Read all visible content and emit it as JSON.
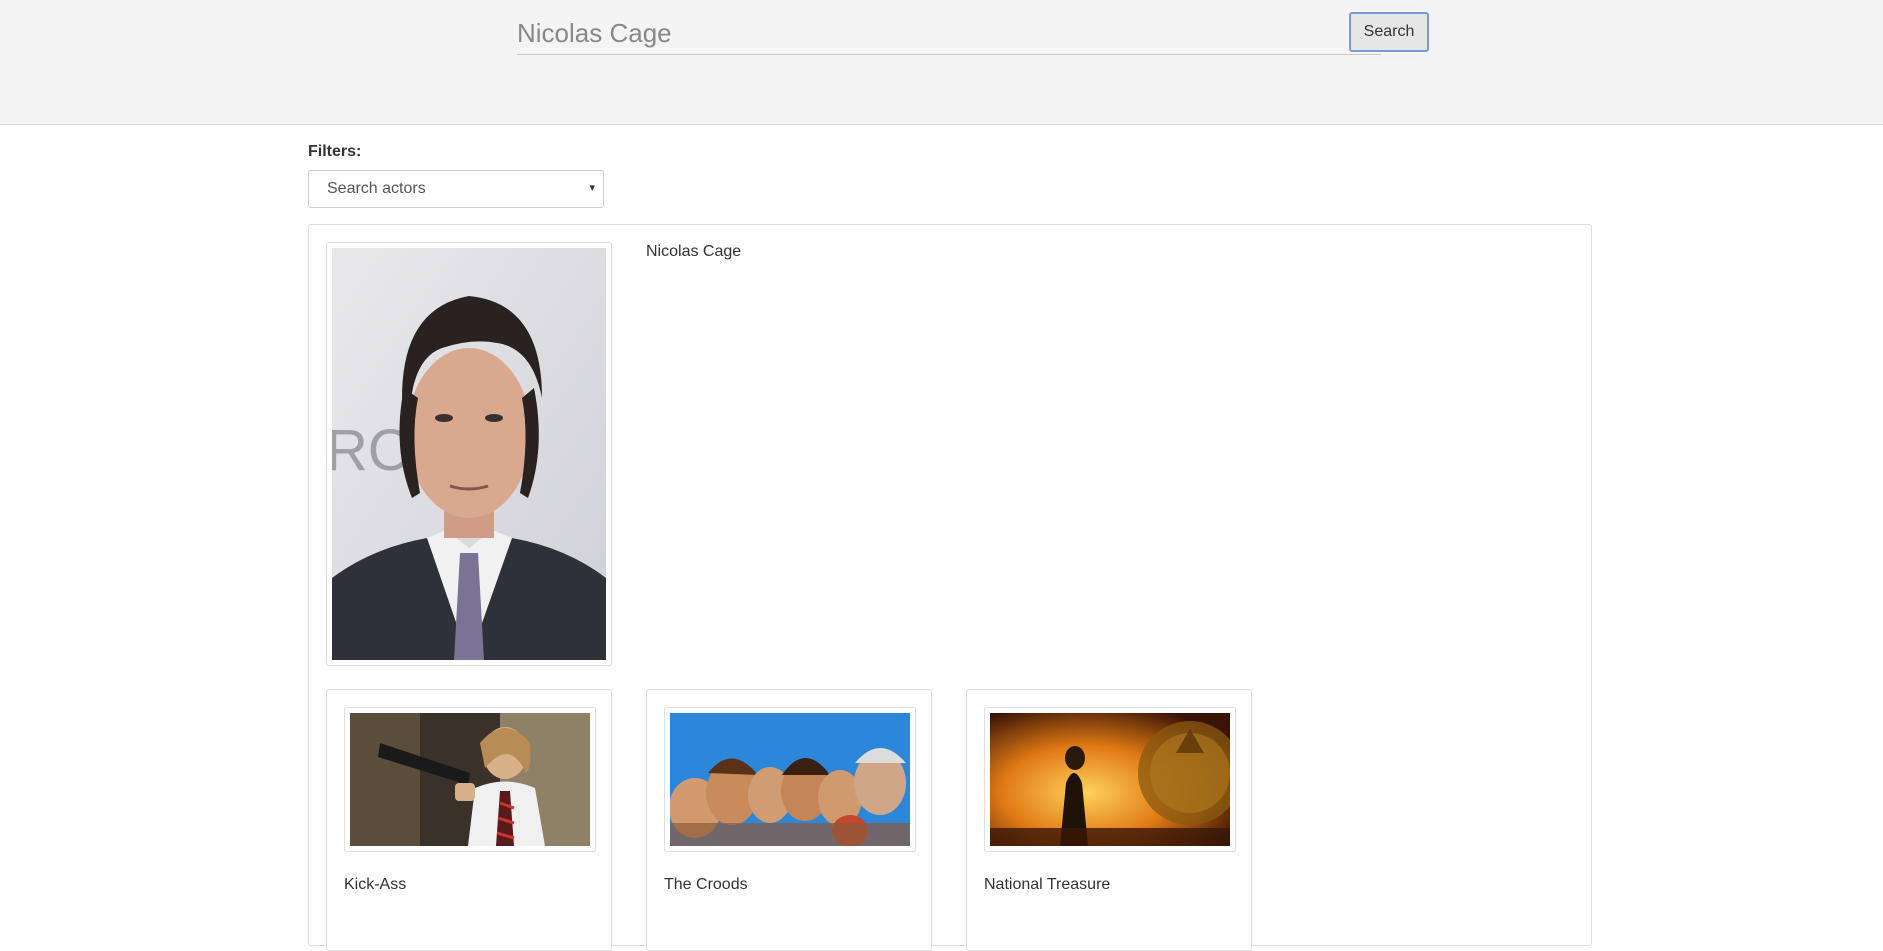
{
  "search": {
    "value": "Nicolas Cage",
    "button_label": "Search"
  },
  "filters": {
    "label": "Filters:",
    "actor_select": {
      "placeholder": "Search actors",
      "caret": "▾"
    }
  },
  "actor": {
    "name": "Nicolas Cage"
  },
  "movies": [
    {
      "title": "Kick-Ass"
    },
    {
      "title": "The Croods"
    },
    {
      "title": "National Treasure"
    }
  ]
}
